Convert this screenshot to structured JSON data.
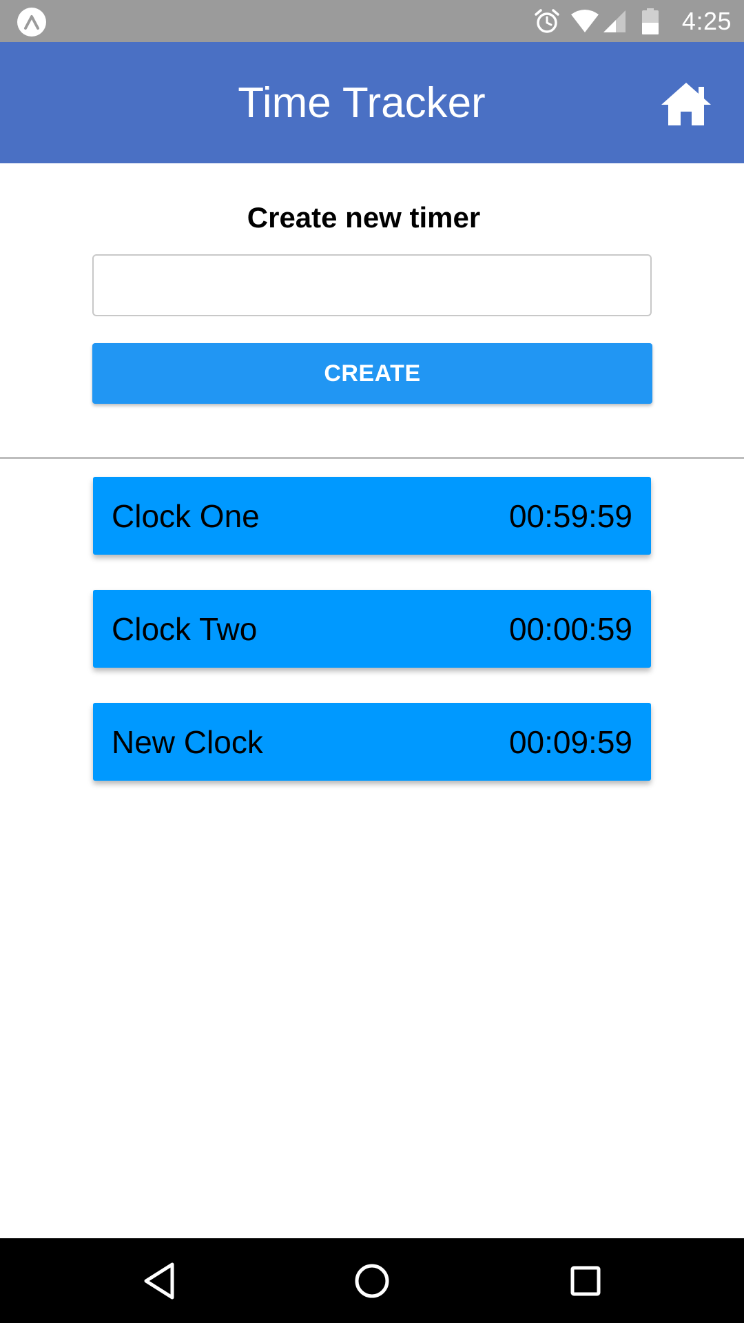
{
  "status_bar": {
    "time": "4:25",
    "icons": [
      "app-notification-icon",
      "alarm-clock-icon",
      "wifi-icon",
      "cell-signal-icon",
      "battery-icon"
    ],
    "color": "#9b9b9b"
  },
  "app_bar": {
    "title": "Time Tracker",
    "action_icon": "home-icon",
    "color": "#4a70c4"
  },
  "create_section": {
    "heading": "Create new timer",
    "input_value": "",
    "input_placeholder": "",
    "button_label": "CREATE",
    "button_color": "#2196f3"
  },
  "timers": [
    {
      "name": "Clock One",
      "time": "00:59:59"
    },
    {
      "name": "Clock Two",
      "time": "00:00:59"
    },
    {
      "name": "New Clock",
      "time": "00:09:59"
    }
  ],
  "timer_color": "#0099ff",
  "nav_bar": {
    "icons": [
      "back-icon",
      "home-circle-icon",
      "recents-icon"
    ]
  }
}
